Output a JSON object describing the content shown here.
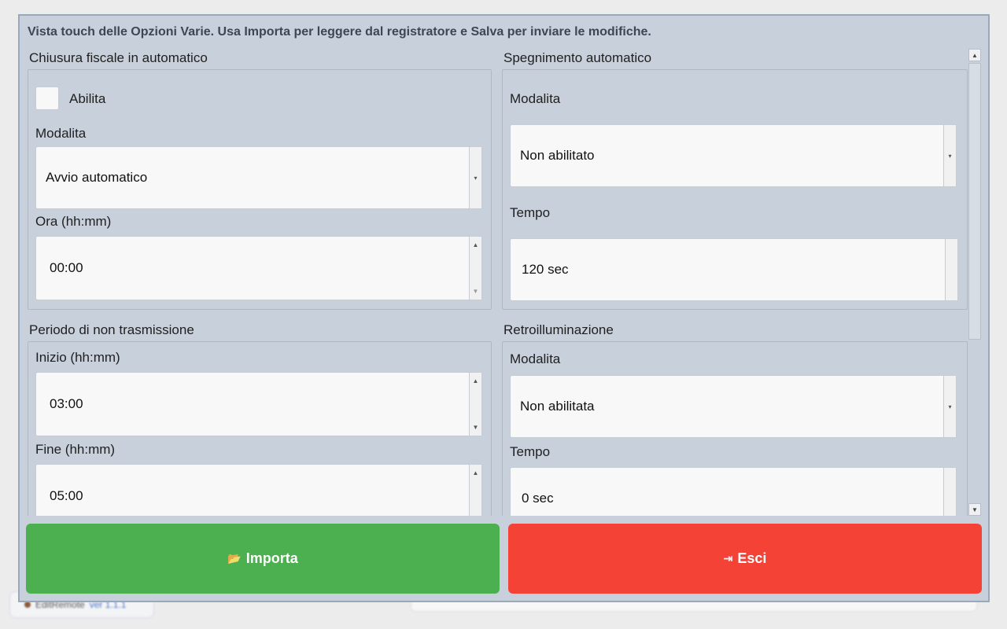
{
  "background": {
    "app_name": "EditRemote",
    "version": "ver 1.1.1"
  },
  "dialog": {
    "header": "Vista touch delle Opzioni Varie. Usa Importa per leggere dal registratore e Salva per inviare le modifiche."
  },
  "chiusura": {
    "title": "Chiusura fiscale in automatico",
    "enable_label": "Abilita",
    "enabled": false,
    "mode_label": "Modalita",
    "mode_value": "Avvio automatico",
    "time_label": "Ora (hh:mm)",
    "time_value": "00:00"
  },
  "spegnimento": {
    "title": "Spegnimento automatico",
    "mode_label": "Modalita",
    "mode_value": "Non abilitato",
    "time_label": "Tempo",
    "time_value": "120 sec"
  },
  "periodo": {
    "title": "Periodo di non trasmissione",
    "start_label": "Inizio (hh:mm)",
    "start_value": "03:00",
    "end_label": "Fine (hh:mm)",
    "end_value": "05:00"
  },
  "retro": {
    "title": "Retroilluminazione",
    "mode_label": "Modalita",
    "mode_value": "Non abilitata",
    "time_label": "Tempo",
    "time_value": "0 sec"
  },
  "buttons": {
    "import_label": "Importa",
    "exit_label": "Esci"
  },
  "colors": {
    "import_button": "#4caf50",
    "exit_button": "#f44336",
    "dialog_bg": "#c8d0dc"
  }
}
